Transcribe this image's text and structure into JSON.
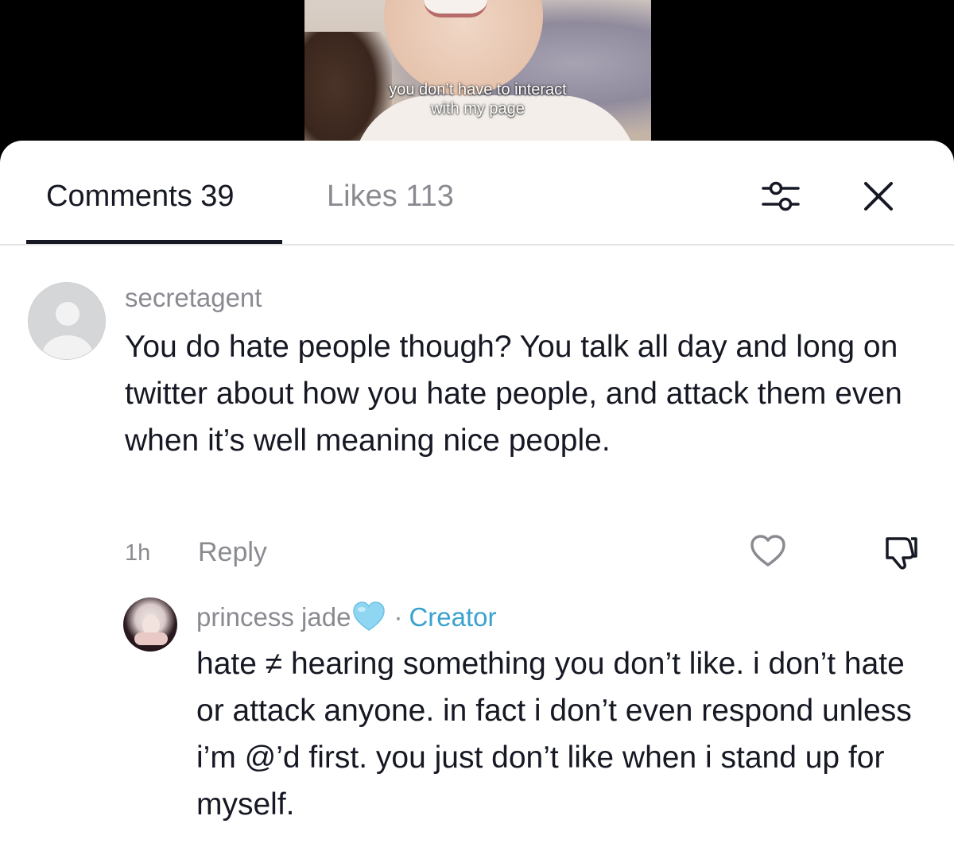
{
  "video": {
    "caption_line1": "you don’t have to interact",
    "caption_line2": "with my page"
  },
  "tabs": {
    "comments_label": "Comments 39",
    "likes_label": "Likes 113",
    "active": "comments"
  },
  "icons": {
    "filter": "filter-sliders-icon",
    "close": "close-icon",
    "like": "heart-outline-icon",
    "dislike": "thumbs-down-icon",
    "heart_emoji": "light-blue-heart-emoji"
  },
  "colors": {
    "text_primary": "#161823",
    "text_secondary": "#8a8b91",
    "creator_badge": "#3aa2cf",
    "heart_emoji": "#8fd6f2"
  },
  "comments": [
    {
      "username": "secretagent",
      "text": "You do hate people though? You talk all day and long on twitter about how you hate people, and attack them even when it’s well meaning nice people.",
      "time": "1h",
      "reply_label": "Reply"
    },
    {
      "username": "princess jade",
      "badge_separator": "·",
      "badge": "Creator",
      "text": "hate ≠ hearing something you don’t like. i don’t hate or attack anyone. in fact i don’t even respond unless i’m @’d first. you just don’t like when i stand up for myself."
    }
  ]
}
